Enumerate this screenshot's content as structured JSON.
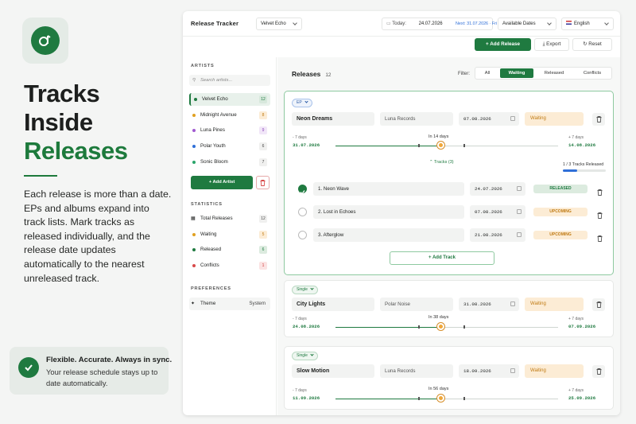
{
  "promo": {
    "headline": [
      "Tracks",
      "Inside",
      "Releases"
    ],
    "description": "Each release is more than a date. EPs and albums expand into track lists. Mark tracks as released individually, and the release date updates automatically to the nearest unreleased track.",
    "callout_title": "Flexible. Accurate. Always in sync.",
    "callout_text": "Your release schedule stays up to date automatically."
  },
  "header": {
    "brand": "Release Tracker",
    "artist_select": "Velvet Echo",
    "today_label": "Today:",
    "today_value": "24.07.2026",
    "next": "Next: 31.07.2026 · Fri",
    "dates_select": "Available Dates",
    "language": "English",
    "add_release": "+ Add Release",
    "export": "Export",
    "reset": "Reset"
  },
  "sidebar": {
    "artists_title": "ARTISTS",
    "search_placeholder": "Search artists...",
    "artists": [
      {
        "name": "Velvet Echo",
        "count": "12",
        "color": "#1f7a40"
      },
      {
        "name": "Midnight Avenue",
        "count": "8",
        "color": "#e0a020"
      },
      {
        "name": "Luna Pines",
        "count": "9",
        "color": "#a05ad0"
      },
      {
        "name": "Polar Youth",
        "count": "6",
        "color": "#2f6fd8"
      },
      {
        "name": "Sonic Bloom",
        "count": "7",
        "color": "#2aa56a"
      }
    ],
    "add_artist": "+ Add Artist",
    "statistics_title": "STATISTICS",
    "stats": [
      {
        "label": "Total Releases",
        "count": "12"
      },
      {
        "label": "Waiting",
        "count": "5",
        "color": "#e0a020"
      },
      {
        "label": "Released",
        "count": "6",
        "color": "#1f7a40"
      },
      {
        "label": "Conflicts",
        "count": "1",
        "color": "#d84a4a"
      }
    ],
    "preferences_title": "PREFERENCES",
    "theme_label": "Theme",
    "theme_value": "System"
  },
  "main": {
    "title": "Releases",
    "count": "12",
    "filter_label": "Filter:",
    "tabs": [
      "All",
      "Waiting",
      "Released",
      "Conflicts"
    ],
    "active_tab": "Waiting"
  },
  "releases": [
    {
      "type": "EP",
      "title": "Neon Dreams",
      "label": "Luna Records",
      "date": "07.08.2026",
      "status": "Waiting",
      "left_lbl": "- 7 days",
      "left_date": "31.07.2026",
      "in_days": "In 14 days",
      "right_lbl": "+ 7 days",
      "right_date": "14.08.2026",
      "tracks_toggle": "⌃ Tracks (3)",
      "tracks_progress_text": "1 / 3 Tracks Released",
      "tracks_progress": 0.33,
      "tracks": [
        {
          "name": "1. Neon Wave",
          "date": "24.07.2026",
          "status": "RELEASED",
          "released": true
        },
        {
          "name": "2. Lost in Echoes",
          "date": "07.08.2026",
          "status": "UPCOMING",
          "released": false
        },
        {
          "name": "3. Afterglow",
          "date": "21.08.2026",
          "status": "UPCOMING",
          "released": false
        }
      ],
      "add_track": "+ Add Track"
    },
    {
      "type": "Single",
      "title": "City Lights",
      "label": "Polar Noise",
      "date": "31.08.2026",
      "status": "Waiting",
      "left_lbl": "- 7 days",
      "left_date": "24.08.2026",
      "in_days": "In 38 days",
      "right_lbl": "+ 7 days",
      "right_date": "07.09.2026"
    },
    {
      "type": "Single",
      "title": "Slow Motion",
      "label": "Luna Records",
      "date": "18.09.2026",
      "status": "Waiting",
      "left_lbl": "- 7 days",
      "left_date": "11.09.2026",
      "in_days": "In 56 days",
      "right_lbl": "+ 7 days",
      "right_date": "25.09.2026"
    }
  ]
}
